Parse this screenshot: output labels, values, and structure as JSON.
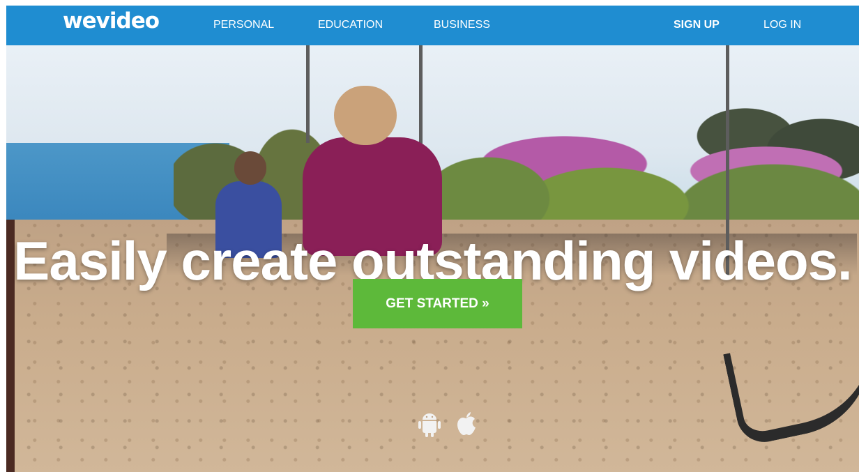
{
  "header": {
    "logo_text": "wevideo",
    "nav": [
      {
        "label": "PERSONAL"
      },
      {
        "label": "EDUCATION"
      },
      {
        "label": "BUSINESS"
      }
    ],
    "sign_up": "SIGN UP",
    "log_in": "LOG IN"
  },
  "hero": {
    "headline": "Easily create outstanding videos.",
    "cta_label": "GET STARTED »",
    "platform_icons": [
      "android-icon",
      "apple-icon"
    ]
  },
  "colors": {
    "nav_bg": "#1f8dd1",
    "cta_bg": "#5db93a",
    "text": "#ffffff"
  }
}
